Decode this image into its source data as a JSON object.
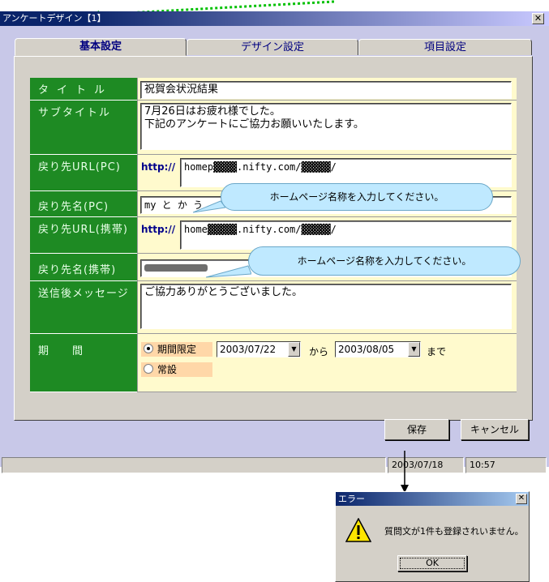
{
  "window": {
    "title": "アンケートデザイン【1】",
    "close_glyph": "✕"
  },
  "tabs": [
    {
      "label": "基本設定"
    },
    {
      "label": "デザイン設定"
    },
    {
      "label": "項目設定"
    }
  ],
  "form": {
    "title": {
      "label": "タイトル",
      "value": "祝賀会状況結果"
    },
    "subtitle": {
      "label": "サブタイトル",
      "value": "7月26日はお疲れ様でした。\n下記のアンケートにご協力お願いいたします。"
    },
    "return_url_pc": {
      "label": "戻り先URL(PC)",
      "prefix": "http://",
      "value": "homep▓▓▓▓.nifty.com/▓▓▓▓▓/"
    },
    "return_name_pc": {
      "label": "戻り先名(PC)",
      "value": "my と か う"
    },
    "return_url_mobile": {
      "label": "戻り先URL(携帯)",
      "prefix": "http://",
      "value": "home▓▓▓▓▓.nifty.com/▓▓▓▓▓/"
    },
    "return_name_mobile": {
      "label": "戻り先名(携帯)",
      "value": ""
    },
    "sent_message": {
      "label": "送信後メッセージ",
      "value": "ご協力ありがとうございました。"
    },
    "period": {
      "label": "期　　間",
      "limited_label": "期間限定",
      "always_label": "常設",
      "start": "2003/07/22",
      "from": "から",
      "end": "2003/08/05",
      "until": "まで"
    }
  },
  "callouts": {
    "pc": "ホームページ名称を入力してください。",
    "mobile": "ホームページ名称を入力してください。"
  },
  "buttons": {
    "save": "保存",
    "cancel": "キャンセル"
  },
  "statusbar": {
    "date": "2003/07/18",
    "time": "10:57"
  },
  "error_dialog": {
    "title": "エラー",
    "close_glyph": "✕",
    "message": "質問文が1件も登録されいません。",
    "ok": "OK"
  },
  "colors": {
    "label_bg": "#1e8a23",
    "cell_bg": "#fffacd",
    "callout_bg": "#bfe9ff",
    "accent_arrow": "#00c000"
  }
}
